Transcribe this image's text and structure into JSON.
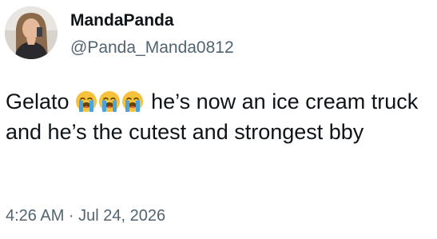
{
  "author": {
    "display_name": "MandaPanda",
    "handle": "@Panda_Manda0812",
    "avatar_icon": "profile-photo"
  },
  "tweet": {
    "text_before_emoji": "Gelato",
    "emoji": [
      "loudly-crying-face",
      "loudly-crying-face",
      "loudly-crying-face"
    ],
    "text_after_emoji": "he’s now an ice cream truck and he’s the cutest and strongest bby",
    "timestamp": "4:26 AM · Jul 24, 2026"
  },
  "colors": {
    "text_primary": "#0f1419",
    "text_secondary": "#536471",
    "emoji_face": "#f7c23b",
    "emoji_tears": "#4aa3df"
  }
}
